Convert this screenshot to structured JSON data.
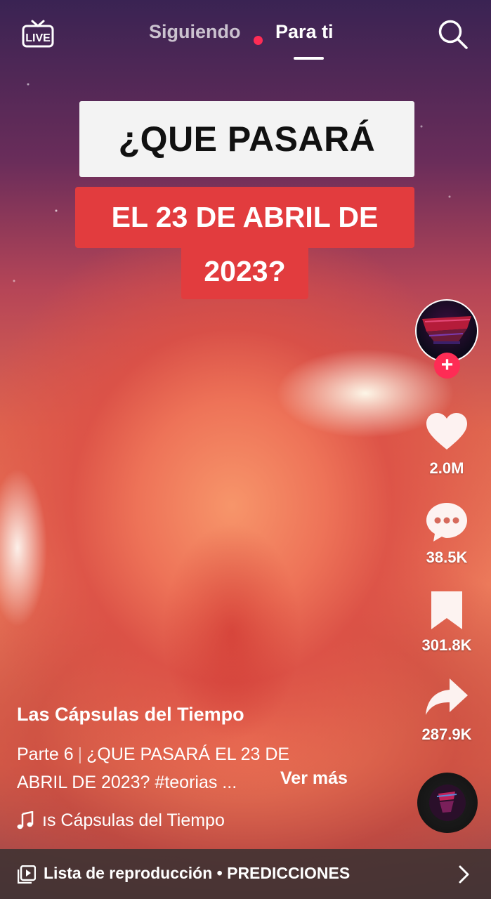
{
  "top_bar": {
    "live_label": "LIVE",
    "tab_following": "Siguiendo",
    "tab_for_you": "Para ti"
  },
  "video_caption": {
    "line1": "¿QUE PASARÁ",
    "line2": "EL 23 DE ABRIL DE",
    "line3": "2023?"
  },
  "sidebar": {
    "follow_symbol": "+",
    "likes": "2.0M",
    "comments": "38.5K",
    "saves": "301.8K",
    "shares": "287.9K"
  },
  "post": {
    "author": "Las Cápsulas del Tiempo",
    "part": "Parte 6",
    "description_line1": "¿QUE PASARÁ EL 23 DE",
    "description_line2": "ABRIL DE 2023? #teorias ...",
    "see_more": "Ver más",
    "sound": "ıs Cápsulas del Tiempo"
  },
  "playlist": {
    "label": "Lista de reproducción • PREDICCIONES"
  },
  "colors": {
    "accent": "#fe2c55",
    "caption_red": "#e23c3e"
  }
}
